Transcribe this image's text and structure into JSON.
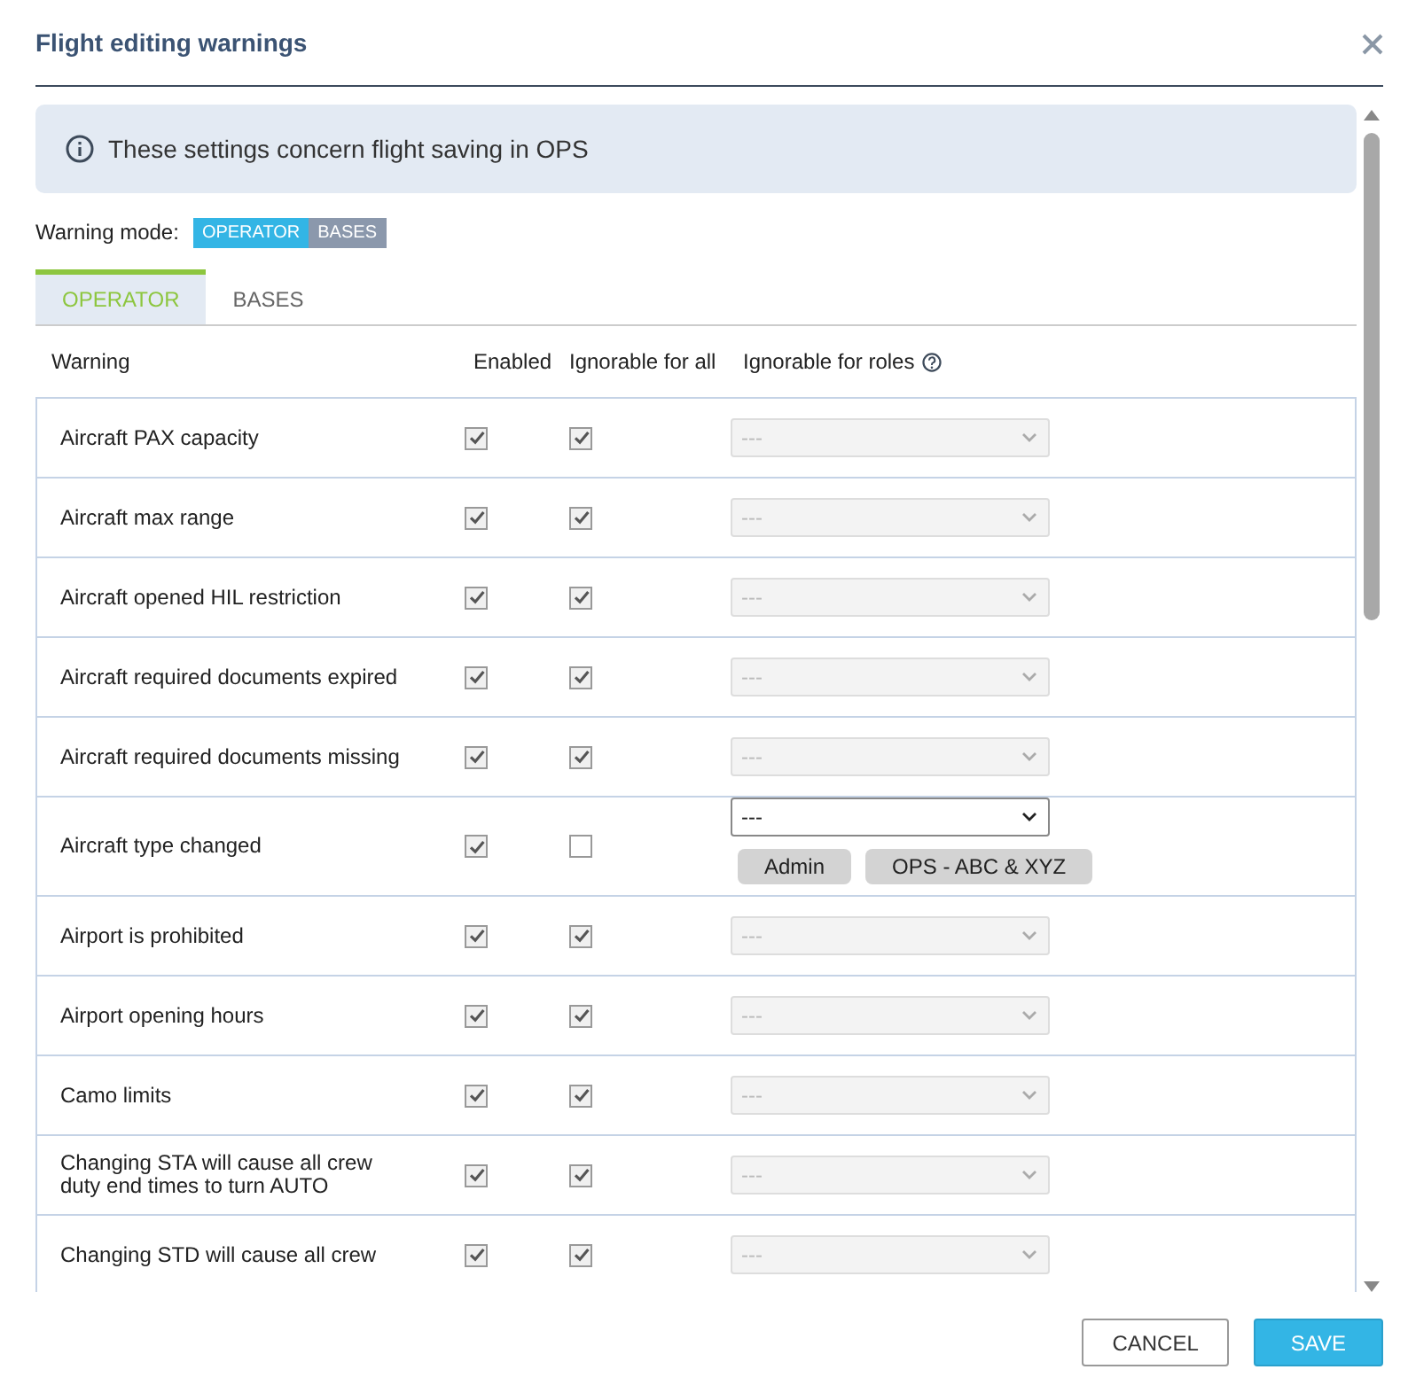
{
  "dialog": {
    "title": "Flight editing warnings"
  },
  "info": "These settings concern flight saving in OPS",
  "warning_mode": {
    "label": "Warning mode:",
    "options": [
      {
        "label": "OPERATOR",
        "selected": true
      },
      {
        "label": "BASES",
        "selected": false
      }
    ]
  },
  "tabs": [
    {
      "label": "OPERATOR",
      "selected": true
    },
    {
      "label": "BASES",
      "selected": false
    }
  ],
  "table": {
    "columns": [
      "Warning",
      "Enabled",
      "Ignorable for all",
      "Ignorable for roles"
    ],
    "rows": [
      {
        "warning": "Aircraft PAX capacity",
        "enabled": true,
        "ignorable_for_all": true,
        "roles_value": "---"
      },
      {
        "warning": "Aircraft max range",
        "enabled": true,
        "ignorable_for_all": true,
        "roles_value": "---"
      },
      {
        "warning": "Aircraft opened HIL restriction",
        "enabled": true,
        "ignorable_for_all": true,
        "roles_value": "---"
      },
      {
        "warning": "Aircraft required documents expired",
        "enabled": true,
        "ignorable_for_all": true,
        "roles_value": "---"
      },
      {
        "warning": "Aircraft required documents missing",
        "enabled": true,
        "ignorable_for_all": true,
        "roles_value": "---"
      },
      {
        "warning": "Aircraft type changed",
        "enabled": true,
        "ignorable_for_all": false,
        "roles_value": "---",
        "roles": [
          "Admin",
          "OPS - ABC & XYZ"
        ]
      },
      {
        "warning": "Airport is prohibited",
        "enabled": true,
        "ignorable_for_all": true,
        "roles_value": "---"
      },
      {
        "warning": "Airport opening hours",
        "enabled": true,
        "ignorable_for_all": true,
        "roles_value": "---"
      },
      {
        "warning": "Camo limits",
        "enabled": true,
        "ignorable_for_all": true,
        "roles_value": "---"
      },
      {
        "warning": "Changing STA will cause all crew duty end times to turn AUTO",
        "enabled": true,
        "ignorable_for_all": true,
        "roles_value": "---"
      },
      {
        "warning": "Changing STD will cause all crew",
        "enabled": true,
        "ignorable_for_all": true,
        "roles_value": "---"
      }
    ]
  },
  "buttons": [
    {
      "label": "CANCEL",
      "kind": "secondary"
    },
    {
      "label": "SAVE",
      "kind": "primary"
    }
  ]
}
